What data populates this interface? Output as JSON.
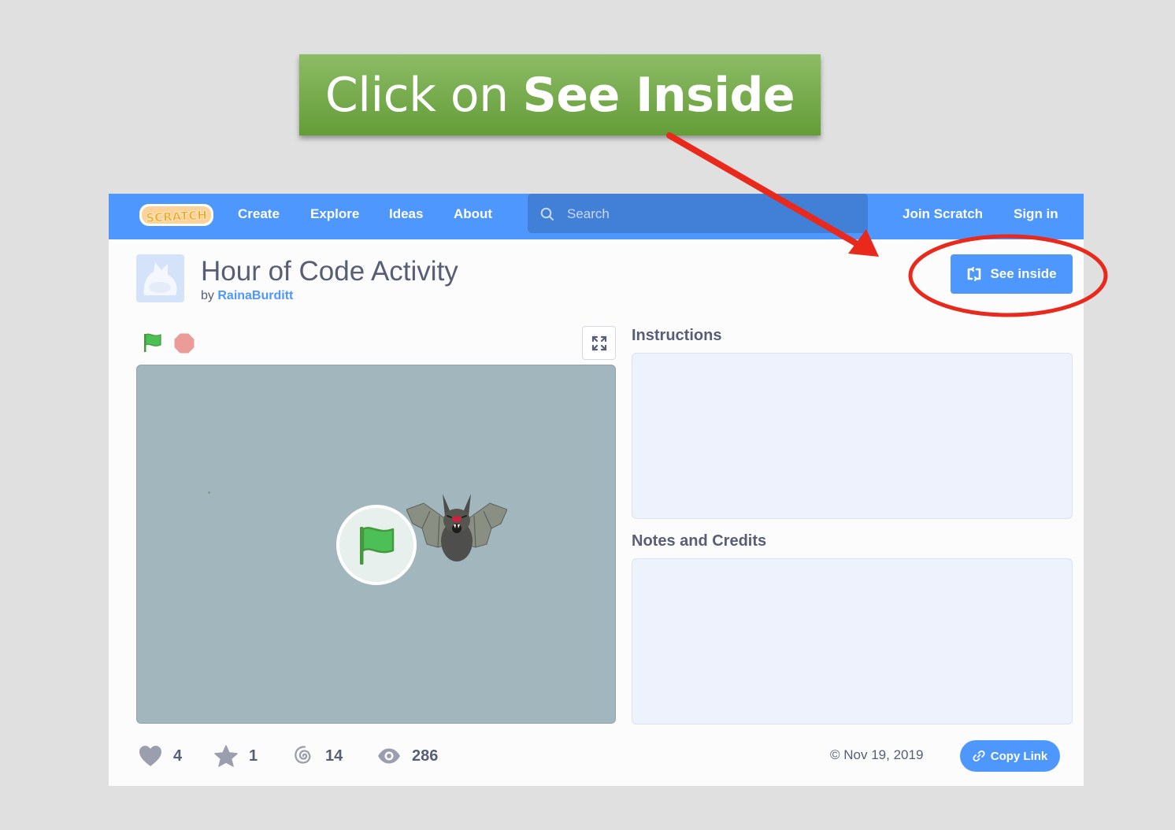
{
  "callout": {
    "prefix": "Click on",
    "emphasis": "See Inside",
    "color": "#6fa844"
  },
  "nav": {
    "logo_text": "SCRATCH",
    "links": [
      "Create",
      "Explore",
      "Ideas",
      "About"
    ],
    "search_placeholder": "Search",
    "join": "Join Scratch",
    "signin": "Sign in",
    "color": "#4d97ff"
  },
  "project": {
    "title": "Hour of Code Activity",
    "by_prefix": "by",
    "author": "RainaBurditt",
    "see_inside_label": "See inside",
    "instructions_title": "Instructions",
    "notes_title": "Notes and Credits"
  },
  "stats": {
    "loves": "4",
    "favorites": "1",
    "remixes": "14",
    "views": "286"
  },
  "footer": {
    "date": "Nov 19, 2019",
    "copy_link_label": "Copy Link"
  },
  "icons": {
    "logo": "scratch-logo",
    "search": "search-icon",
    "see_inside": "remix-arrows-icon",
    "green_flag": "green-flag-icon",
    "stop": "stop-sign-icon",
    "fullscreen": "fullscreen-icon",
    "love": "heart-icon",
    "favorite": "star-icon",
    "remix": "swirl-icon",
    "view": "eye-icon",
    "date": "copyright-icon",
    "copy_link": "link-icon"
  },
  "annotation_color": "#e8291c"
}
